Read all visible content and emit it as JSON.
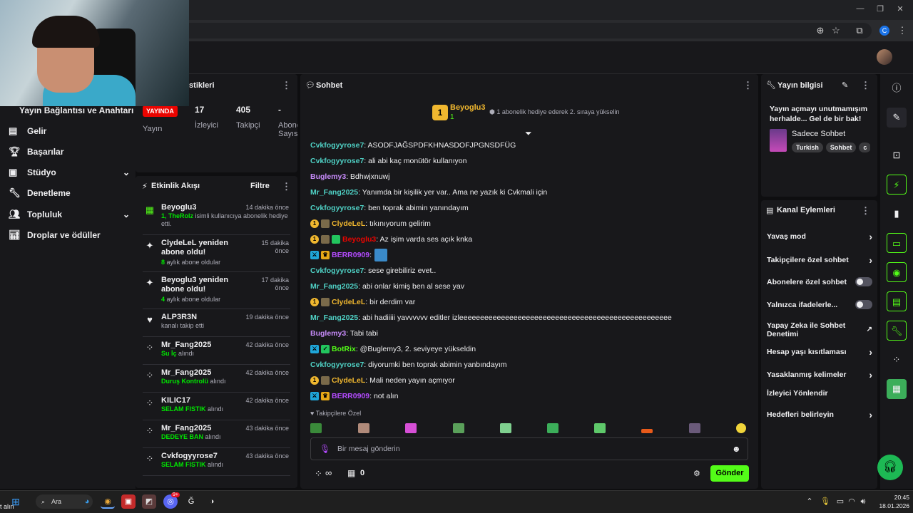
{
  "browser": {
    "tab_badge": "C"
  },
  "webcam": {
    "text": ""
  },
  "left_nav": {
    "title": "Yayın Bağlantısı ve Anahtarı",
    "items": [
      {
        "label": "Gelir",
        "icon": "money-icon"
      },
      {
        "label": "Başarılar",
        "icon": "trophy-icon"
      },
      {
        "label": "Stüdyo",
        "icon": "studio-icon",
        "expand": "⌄"
      },
      {
        "label": "Denetleme",
        "icon": "wrench-icon"
      },
      {
        "label": "Topluluk",
        "icon": "community-icon",
        "expand": "⌄"
      },
      {
        "label": "Droplar ve ödüller",
        "icon": "drops-icon"
      }
    ]
  },
  "stats": {
    "title": "istikleri",
    "live_badge": "YAYINDA",
    "live_label": "Yayın",
    "viewers": "17",
    "viewers_label": "İzleyici",
    "followers": "405",
    "followers_label": "Takipçi",
    "subs": "-",
    "subs_label": "Abone Sayısı"
  },
  "feed": {
    "title": "Etkinlik Akışı",
    "filter": "Filtre",
    "items": [
      {
        "name": "Beyoglu3",
        "time": "14 dakika önce",
        "sub_green": "1, TheRolz",
        "sub_rest": " isimli kullanıcıya abonelik hediye etti.",
        "icon": "gift-icon"
      },
      {
        "name": "ClydeLeL yeniden abone oldu!",
        "time": "15 dakika önce",
        "sub_green": "8",
        "sub_rest": " aylık abone oldular",
        "icon": "sparkle-icon"
      },
      {
        "name": "Beyoglu3 yeniden abone oldu!",
        "time": "17 dakika önce",
        "sub_green": "4",
        "sub_rest": " aylık abone oldular",
        "icon": "sparkle-icon"
      },
      {
        "name": "ALP3R3N",
        "time": "19 dakika önce",
        "sub_green": "",
        "sub_rest": "kanalı takip etti",
        "icon": "heart-icon"
      },
      {
        "name": "Mr_Fang2025",
        "time": "42 dakika önce",
        "sub_green": "Su İç",
        "sub_rest": " alındı",
        "icon": "points-icon"
      },
      {
        "name": "Mr_Fang2025",
        "time": "42 dakika önce",
        "sub_green": "Duruş Kontrolü",
        "sub_rest": " alındı",
        "icon": "points-icon"
      },
      {
        "name": "KILIC17",
        "time": "42 dakika önce",
        "sub_green": "SELAM FISTIK",
        "sub_rest": " alındı",
        "icon": "points-icon"
      },
      {
        "name": "Mr_Fang2025",
        "time": "43 dakika önce",
        "sub_green": "DEDEYE BAN",
        "sub_rest": " alındı",
        "icon": "points-icon"
      },
      {
        "name": "Cvkfogyyrose7",
        "time": "43 dakika önce",
        "sub_green": "SELAM FISTIK",
        "sub_rest": " alındı",
        "icon": "points-icon"
      }
    ]
  },
  "chat": {
    "title": "Sohbet",
    "pinned": {
      "user": "Beyoglu3",
      "count": "1",
      "rank": "1",
      "text": "1 abonelik hediye ederek 2. sıraya yükselin"
    },
    "messages": [
      {
        "user": "Cvkfogyyrose7",
        "color": "#4fd1c5",
        "text": ": ASODFJAĞSPDFKHNASDOFJPGNSDFÜG",
        "badges": []
      },
      {
        "user": "Cvkfogyyrose7",
        "color": "#4fd1c5",
        "text": ": ali abi kaç monütör kullanıyon",
        "badges": []
      },
      {
        "user": "Buglemy3",
        "color": "#c78bfa",
        "text": ": Bdhwjxnuwj",
        "badges": []
      },
      {
        "user": "Mr_Fang2025",
        "color": "#4fd1c5",
        "text": ": Yanımda bir kişilik yer var.. Ama ne yazık ki Cvkmali için",
        "badges": []
      },
      {
        "user": "Cvkfogyyrose7",
        "color": "#4fd1c5",
        "text": ": ben toprak abimin yanındayım",
        "badges": []
      },
      {
        "user": "ClydeLeL",
        "color": "#f0b72f",
        "text": ": tıkınıyorum gelirim",
        "badges": [
          "sub",
          "img"
        ]
      },
      {
        "user": "Beyoglu3",
        "color": "#eb0400",
        "text": ": Az işim varda ses açık knka",
        "badges": [
          "sub",
          "img",
          "gift"
        ]
      },
      {
        "user": "BERR0909",
        "color": "#b44bff",
        "text": ":",
        "badges": [
          "mod",
          "vip"
        ]
      },
      {
        "user": "Cvkfogyyrose7",
        "color": "#4fd1c5",
        "text": ": sese girebiliriz evet..",
        "badges": []
      },
      {
        "user": "Mr_Fang2025",
        "color": "#4fd1c5",
        "text": ": abi onlar kimiş ben al sese yav",
        "badges": []
      },
      {
        "user": "ClydeLeL",
        "color": "#f0b72f",
        "text": ": bir derdim var",
        "badges": [
          "sub",
          "img"
        ]
      },
      {
        "user": "Mr_Fang2025",
        "color": "#4fd1c5",
        "text": ": abi hadiiiii yavvvvvv editler izleeeeeeeeeeeeeeeeeeeeeeeeeeeeeeeeeeeeeeeeeeeeeeeeeee",
        "badges": []
      },
      {
        "user": "Buglemy3",
        "color": "#c78bfa",
        "text": ": Tabi tabi",
        "badges": []
      },
      {
        "user": "BotRix",
        "color": "#53fc18",
        "text": ": @Buglemy3, 2. seviyeye yükseldin",
        "badges": [
          "mod",
          "bot"
        ]
      },
      {
        "user": "Cvkfogyyrose7",
        "color": "#4fd1c5",
        "text": ": diyorumki ben toprak abimin yanbındayım",
        "badges": []
      },
      {
        "user": "ClydeLeL",
        "color": "#f0b72f",
        "text": ": Mali neden yayın açmıyor",
        "badges": [
          "sub",
          "img"
        ]
      },
      {
        "user": "BERR0909",
        "color": "#b44bff",
        "text": ": not alın",
        "badges": [
          "mod",
          "vip"
        ]
      }
    ],
    "followers_only": "Takipçilere Özel",
    "input_placeholder": "Bir mesaj gönderin",
    "points": "∞",
    "gifts": "0",
    "send": "Gönder"
  },
  "info": {
    "title": "Yayın bilgisi",
    "stream_title": "Yayın açmayı unutmamışım herhalde... Gel de bir bak!",
    "category": "Sadece Sohbet",
    "tags": [
      "Turkish",
      "Sohbet",
      "c"
    ]
  },
  "actions": {
    "title": "Kanal Eylemleri",
    "items": [
      {
        "label": "Yavaş mod",
        "type": "chevron"
      },
      {
        "label": "Takipçilere özel sohbet",
        "type": "chevron"
      },
      {
        "label": "Abonelere özel sohbet",
        "type": "toggle"
      },
      {
        "label": "Yalnızca ifadelerle...",
        "type": "toggle"
      },
      {
        "label": "Yapay Zeka ile Sohbet Denetimi",
        "type": "external"
      },
      {
        "label": "Hesap yaşı kısıtlaması",
        "type": "chevron"
      },
      {
        "label": "Yasaklanmış kelimeler",
        "type": "chevron"
      },
      {
        "label": "İzleyici Yönlendir",
        "type": "none"
      },
      {
        "label": "Hedefleri belirleyin",
        "type": "chevron"
      }
    ]
  },
  "taskbar": {
    "search": "Ara",
    "time": "20:45",
    "date": "18.01.2026",
    "corner_text": "t alın",
    "notif_badge": "9+"
  },
  "colors": {
    "accent": "#53fc18",
    "live": "#eb0400",
    "panel": "#18181b",
    "bg": "#0e0e10"
  }
}
